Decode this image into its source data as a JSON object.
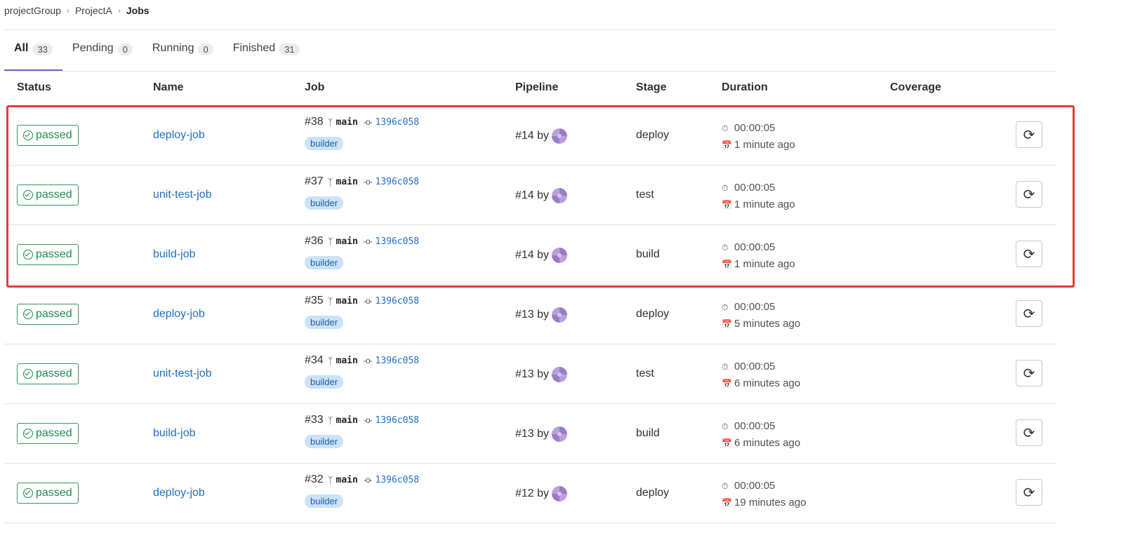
{
  "breadcrumb": {
    "items": [
      "projectGroup",
      "ProjectA"
    ],
    "current": "Jobs"
  },
  "tabs": [
    {
      "label": "All",
      "count": "33"
    },
    {
      "label": "Pending",
      "count": "0"
    },
    {
      "label": "Running",
      "count": "0"
    },
    {
      "label": "Finished",
      "count": "31"
    }
  ],
  "columns": {
    "status": "Status",
    "name": "Name",
    "job": "Job",
    "pipeline": "Pipeline",
    "stage": "Stage",
    "duration": "Duration",
    "coverage": "Coverage"
  },
  "icons": {
    "branch": "branch-icon",
    "commit": "commit-icon",
    "timer": "timer-icon",
    "calendar": "calendar-icon",
    "retry": "retry-icon",
    "check": "check-circle-icon"
  },
  "colors": {
    "passed": "#1f8a50",
    "link": "#1f6fc5",
    "highlight": "#e83a3a",
    "tab_active": "#6666c4"
  },
  "jobs": [
    {
      "status": "passed",
      "name": "deploy-job",
      "id": "#38",
      "branch": "main",
      "sha": "1396c058",
      "tag": "builder",
      "pipeline": "#14 by",
      "stage": "deploy",
      "duration": "00:00:05",
      "finished": "1 minute ago"
    },
    {
      "status": "passed",
      "name": "unit-test-job",
      "id": "#37",
      "branch": "main",
      "sha": "1396c058",
      "tag": "builder",
      "pipeline": "#14 by",
      "stage": "test",
      "duration": "00:00:05",
      "finished": "1 minute ago"
    },
    {
      "status": "passed",
      "name": "build-job",
      "id": "#36",
      "branch": "main",
      "sha": "1396c058",
      "tag": "builder",
      "pipeline": "#14 by",
      "stage": "build",
      "duration": "00:00:05",
      "finished": "1 minute ago"
    },
    {
      "status": "passed",
      "name": "deploy-job",
      "id": "#35",
      "branch": "main",
      "sha": "1396c058",
      "tag": "builder",
      "pipeline": "#13 by",
      "stage": "deploy",
      "duration": "00:00:05",
      "finished": "5 minutes ago"
    },
    {
      "status": "passed",
      "name": "unit-test-job",
      "id": "#34",
      "branch": "main",
      "sha": "1396c058",
      "tag": "builder",
      "pipeline": "#13 by",
      "stage": "test",
      "duration": "00:00:05",
      "finished": "6 minutes ago"
    },
    {
      "status": "passed",
      "name": "build-job",
      "id": "#33",
      "branch": "main",
      "sha": "1396c058",
      "tag": "builder",
      "pipeline": "#13 by",
      "stage": "build",
      "duration": "00:00:05",
      "finished": "6 minutes ago"
    },
    {
      "status": "passed",
      "name": "deploy-job",
      "id": "#32",
      "branch": "main",
      "sha": "1396c058",
      "tag": "builder",
      "pipeline": "#12 by",
      "stage": "deploy",
      "duration": "00:00:05",
      "finished": "19 minutes ago"
    }
  ]
}
